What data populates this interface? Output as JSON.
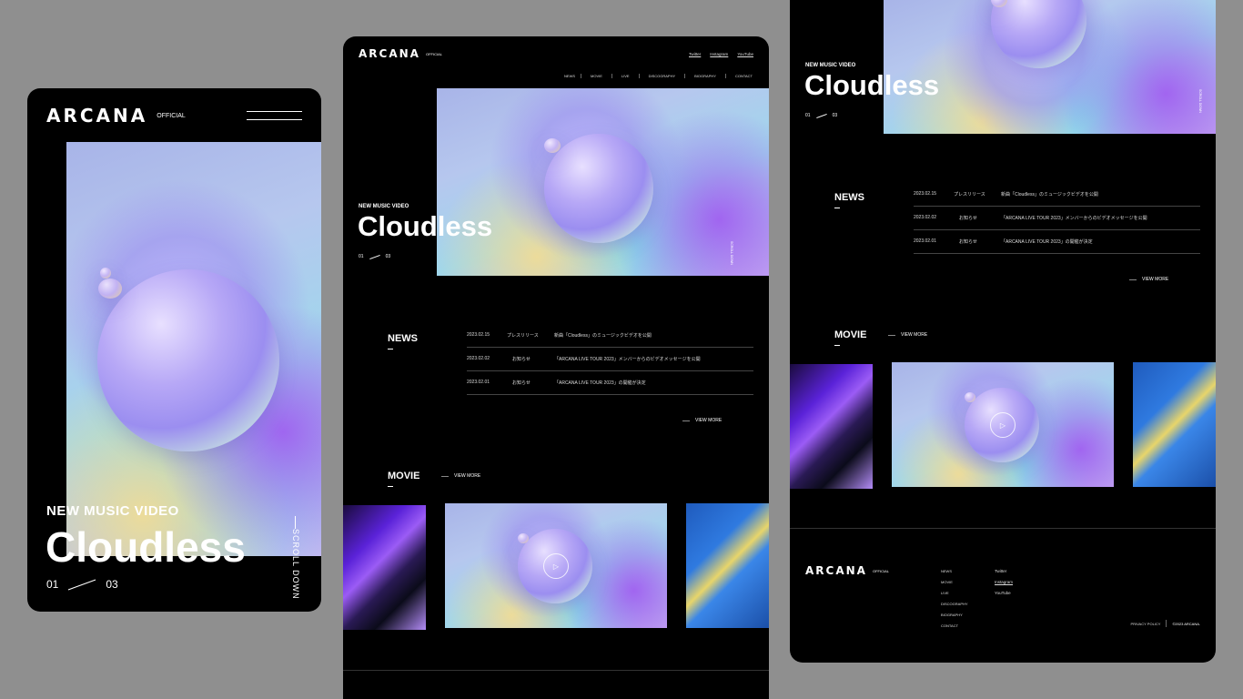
{
  "brand": {
    "name": "ARCANA",
    "sub": "OFFICIAL"
  },
  "hero": {
    "kicker": "NEW MUSIC VIDEO",
    "title": "Cloudless",
    "page_current": "01",
    "page_total": "03",
    "scroll_label": "SCROLL DOWN",
    "side_label": "SCROLL DOWN"
  },
  "nav": [
    "NEWS",
    "MOVIE",
    "LIVE",
    "DISCOGRAPHY",
    "BIOGRAPHY",
    "CONTACT"
  ],
  "social": [
    "Twitter",
    "Instagram",
    "YouTube"
  ],
  "news": {
    "heading": "NEWS",
    "items": [
      {
        "date": "2023.02.15",
        "category": "プレスリリース",
        "title": "新曲「Cloudless」のミュージックビデオを公開"
      },
      {
        "date": "2023.02.02",
        "category": "お知らせ",
        "title": "「ARCANA LIVE TOUR 2023」メンバーからのビデオメッセージを公開"
      },
      {
        "date": "2023.02.01",
        "category": "お知らせ",
        "title": "「ARCANA LIVE TOUR 2023」の開催が決定"
      }
    ],
    "view_more": "VIEW MORE"
  },
  "movie": {
    "heading": "MOVIE",
    "view_more": "VIEW MORE"
  },
  "footer": {
    "links": [
      "NEWS",
      "MOVIE",
      "LIVE",
      "DISCOGRAPHY",
      "BIOGRAPHY",
      "CONTACT"
    ],
    "social": [
      "Twitter",
      "Instagram",
      "YouTube"
    ],
    "privacy": "PRIVACY POLICY",
    "copyright": "©2023 ARCANA."
  }
}
